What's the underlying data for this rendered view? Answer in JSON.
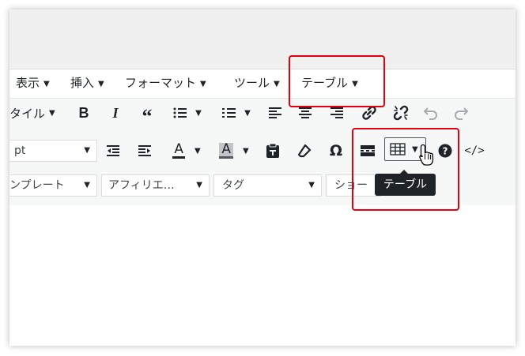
{
  "menubar": {
    "items": [
      {
        "label": "表示"
      },
      {
        "label": "挿入"
      },
      {
        "label": "フォーマット"
      },
      {
        "label": "ツール"
      },
      {
        "label": "テーブル"
      }
    ]
  },
  "toolbar": {
    "format_label": "タイル",
    "font_size_value": "pt",
    "template_select": "ンプレート",
    "affiliate_select": "アフィリエ…",
    "tag_select": "タグ",
    "shortcode_select": "ショー"
  },
  "tooltip": {
    "text": "テーブル"
  },
  "colors": {
    "highlight": "#e3000f",
    "tooltip_bg": "#1d2327",
    "toolbar_bg": "#f6f7f7"
  }
}
